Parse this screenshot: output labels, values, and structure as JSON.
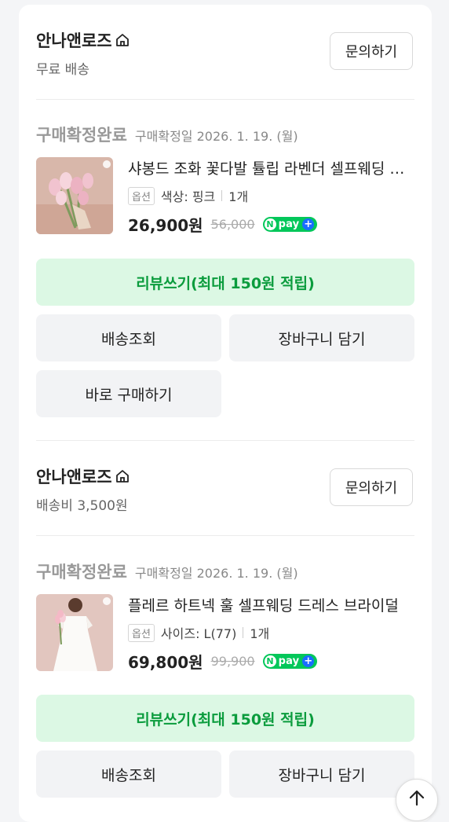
{
  "orders": [
    {
      "store_name": "안나앤로즈",
      "shipping": "무료 배송",
      "inquiry_label": "문의하기",
      "status": "구매확정완료",
      "confirm_date": "구매확정일 2026. 1. 19. (월)",
      "product_name": "샤봉드 조화 꽃다발 튤립 라벤더 셀프웨딩 부케",
      "option_badge": "옵션",
      "option_text": "색상: 핑크",
      "quantity": "1개",
      "price": "26,900원",
      "original_price": "56,000",
      "npay_label": "pay",
      "review_label": "리뷰쓰기(최대 150원 적립)",
      "delivery_label": "배송조회",
      "cart_label": "장바구니 담기",
      "buy_label": "바로 구매하기",
      "thumb_colors": {
        "bg": "#d8b7aa",
        "flower": "#f1c3cf",
        "leaf": "#7e9b5d"
      }
    },
    {
      "store_name": "안나앤로즈",
      "shipping": "배송비 3,500원",
      "inquiry_label": "문의하기",
      "status": "구매확정완료",
      "confirm_date": "구매확정일 2026. 1. 19. (월)",
      "product_name": "플레르 하트넥 훌 셀프웨딩 드레스 브라이덜",
      "option_badge": "옵션",
      "option_text": "사이즈: L(77)",
      "quantity": "1개",
      "price": "69,800원",
      "original_price": "99,900",
      "npay_label": "pay",
      "review_label": "리뷰쓰기(최대 150원 적립)",
      "delivery_label": "배송조회",
      "cart_label": "장바구니 담기",
      "thumb_colors": {
        "bg": "#e2c6bf",
        "dress": "#fbfaf8",
        "flower": "#f4b9c6"
      }
    }
  ],
  "colors": {
    "review_bg": "#dcf8e4",
    "review_text": "#0b9c3d",
    "npay_green": "#03c75a"
  },
  "icons": [
    "home-icon",
    "arrow-up-icon"
  ]
}
